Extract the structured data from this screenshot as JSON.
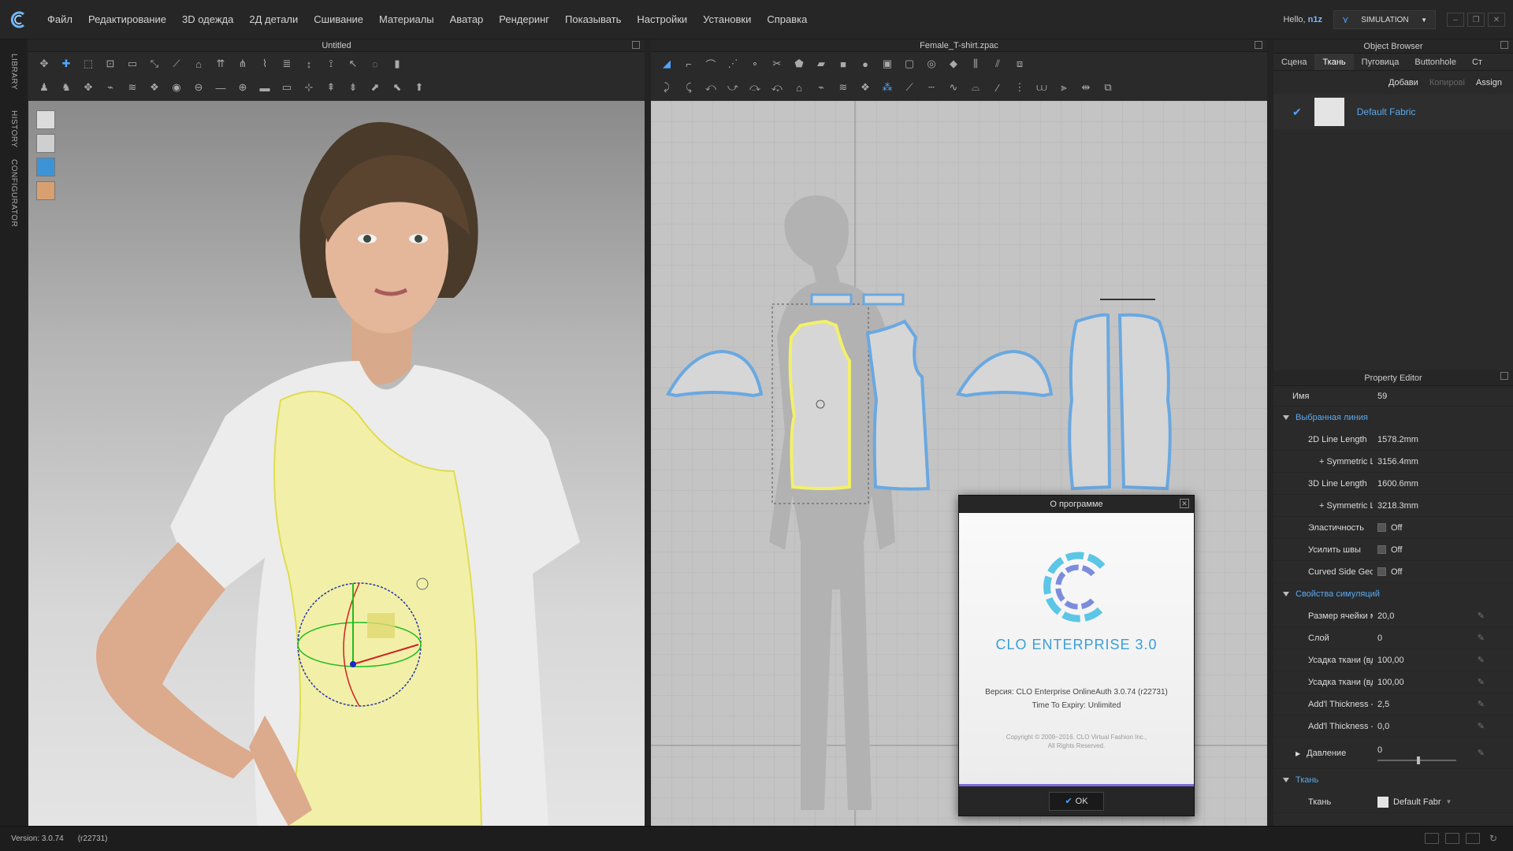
{
  "menu": [
    "Файл",
    "Редактирование",
    "3D одежда",
    "2Д детали",
    "Сшивание",
    "Материалы",
    "Аватар",
    "Рендеринг",
    "Показывать",
    "Настройки",
    "Установки",
    "Справка"
  ],
  "user": {
    "greeting": "Hello,",
    "name": "n1z"
  },
  "simulation_label": "SIMULATION",
  "left_tabs": [
    "LIBRARY",
    "HISTORY",
    "CONFIGURATOR"
  ],
  "view3d": {
    "title": "Untitled"
  },
  "view2d": {
    "title": "Female_T-shirt.zpac"
  },
  "object_browser": {
    "title": "Object Browser",
    "tabs": [
      "Сцена",
      "Ткань",
      "Пуговица",
      "Buttonhole",
      "Ст"
    ],
    "active_tab": "Ткань",
    "actions": {
      "add": "Добави",
      "copy": "Копирові",
      "assign": "Assign"
    },
    "fabric_name": "Default Fabric"
  },
  "property_editor": {
    "title": "Property Editor",
    "name_label": "Имя",
    "name_value": "59",
    "section_line": "Выбранная линия",
    "line_rows": [
      {
        "k": "2D Line Length",
        "v": "1578.2mm",
        "sub": false
      },
      {
        "k": "+ Symmetric Line Lt",
        "v": "3156.4mm",
        "sub": true
      },
      {
        "k": "3D Line Length",
        "v": "1600.6mm",
        "sub": false
      },
      {
        "k": "+ Symmetric Line Lt",
        "v": "3218.3mm",
        "sub": true
      }
    ],
    "toggle_rows": [
      {
        "k": "Эластичность",
        "v": "Off"
      },
      {
        "k": "Усилить швы",
        "v": "Off"
      },
      {
        "k": "Curved Side Geome",
        "v": "Off"
      }
    ],
    "section_sim": "Свойства симуляций",
    "sim_rows": [
      {
        "k": "Размер ячейки меша",
        "v": "20,0"
      },
      {
        "k": "Слой",
        "v": "0"
      },
      {
        "k": "Усадка ткани (вдоль у",
        "v": "100,00"
      },
      {
        "k": "Усадка ткани (вдоль о",
        "v": "100,00"
      },
      {
        "k": "Add'l Thickness - Collisic",
        "v": "2,5"
      },
      {
        "k": "Add'l Thickness - Render",
        "v": "0,0"
      }
    ],
    "pressure_label": "Давление",
    "pressure_value": "0",
    "section_fabric": "Ткань",
    "fabric_label": "Ткань",
    "fabric_value": "Default Fabr"
  },
  "dialog": {
    "title": "О программе",
    "product": "CLO ENTERPRISE 3.0",
    "version": "Версия: CLO Enterprise OnlineAuth 3.0.74     (r22731)",
    "expiry": "Time To Expiry: Unlimited",
    "copyright": "Copyright © 2009~2016. CLO Virtual Fashion Inc.,",
    "rights": "All Rights Reserved.",
    "ok": "OK"
  },
  "status": {
    "version": "Version: 3.0.74",
    "build": "(r22731)"
  },
  "colors": {
    "accent": "#4da6ff",
    "selection": "#f2f06a",
    "pattern_outline": "#6aa8e0",
    "dialog_accent": "#7d6bd8"
  }
}
